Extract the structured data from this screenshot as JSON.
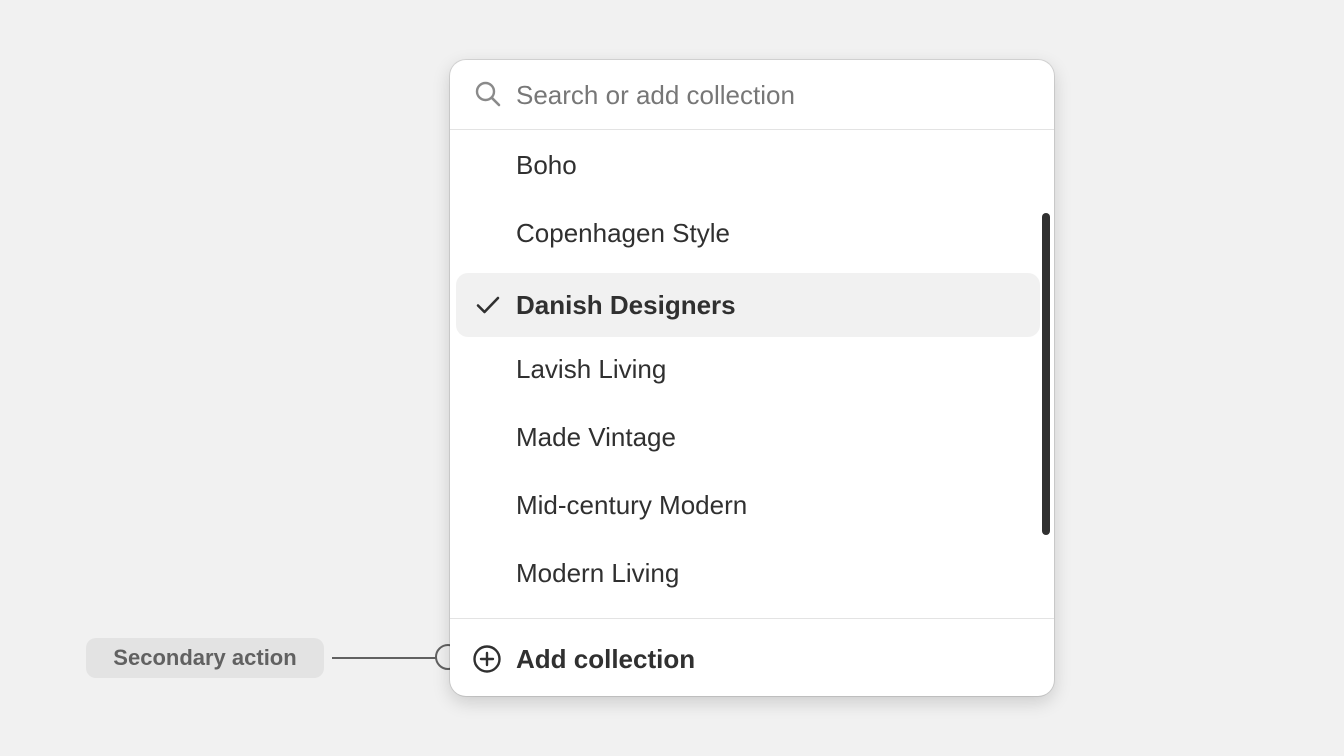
{
  "search": {
    "placeholder": "Search or add collection",
    "value": "",
    "icon": "search-icon"
  },
  "options": [
    {
      "label": "Boho",
      "selected": false
    },
    {
      "label": "Copenhagen Style",
      "selected": false
    },
    {
      "label": "Danish Designers",
      "selected": true
    },
    {
      "label": "Lavish Living",
      "selected": false
    },
    {
      "label": "Made Vintage",
      "selected": false
    },
    {
      "label": "Mid-century Modern",
      "selected": false
    },
    {
      "label": "Modern Living",
      "selected": false
    }
  ],
  "footer": {
    "add_label": "Add collection",
    "icon": "plus-circle-icon"
  },
  "annotation": {
    "label": "Secondary action"
  },
  "colors": {
    "background": "#f1f1f1",
    "surface": "#ffffff",
    "text": "#303030",
    "placeholder": "#777777",
    "selected_bg": "#f1f1f1",
    "divider": "#e3e3e3",
    "annotation_bg": "#e3e3e3",
    "annotation_text": "#616161"
  }
}
